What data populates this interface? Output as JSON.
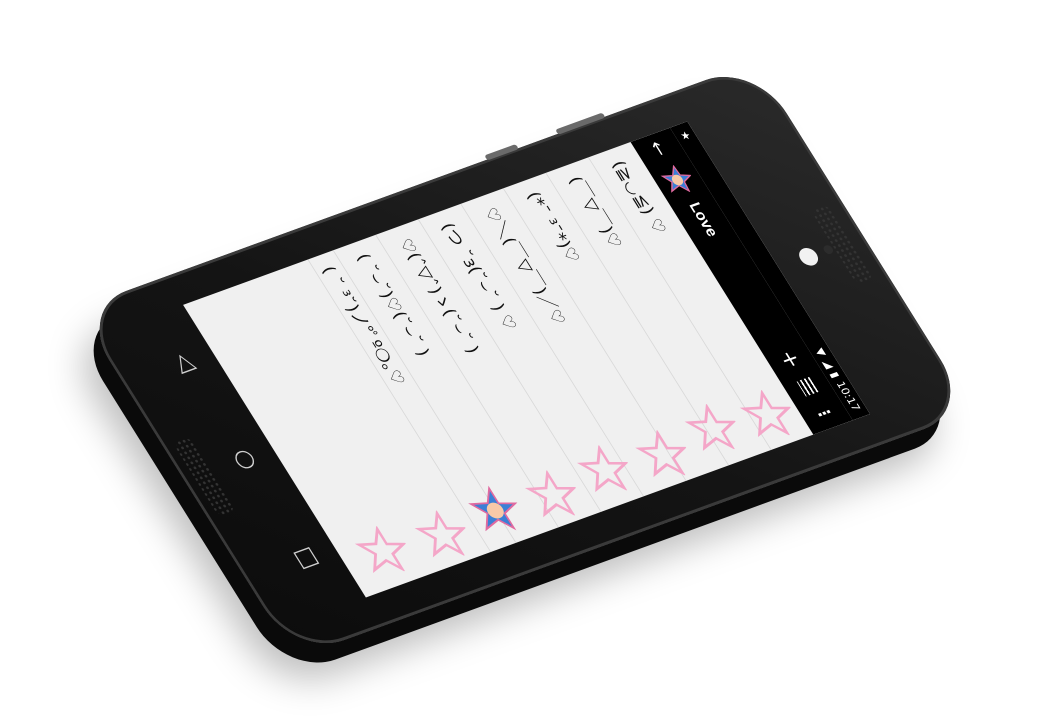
{
  "status_bar": {
    "time": "10:17"
  },
  "app_bar": {
    "back_icon": "arrow-left-icon",
    "title": "Love",
    "add_icon": "plus-icon",
    "list_icon": "list-icon",
    "more_icon": "overflow-menu-icon"
  },
  "emoticons": [
    "(≧◡≦) ♡",
    "(￣▽￣)♡",
    "(*¯ ³¯*)♡",
    "♡＼(￣▽￣)／♡",
    "(つ ˘з(˘⌣˘ ) ♡",
    "♡(ˆ▽ˆ)ゝ(˘⌣˘ )",
    "( ˘⌣˘)♡(˘⌣˘ )",
    "( ˘ ³˘)ノ°ﾟº❍｡♡"
  ],
  "nav_bar": {
    "back_icon": "nav-back-triangle-icon",
    "home_icon": "nav-home-circle-icon",
    "recents_icon": "nav-recents-square-icon"
  },
  "colors": {
    "star_pink": "#f4a6c8",
    "accent_star_blue": "#3b7fd6",
    "screen_bg": "#f0f0f0",
    "bar_bg": "#000000"
  }
}
